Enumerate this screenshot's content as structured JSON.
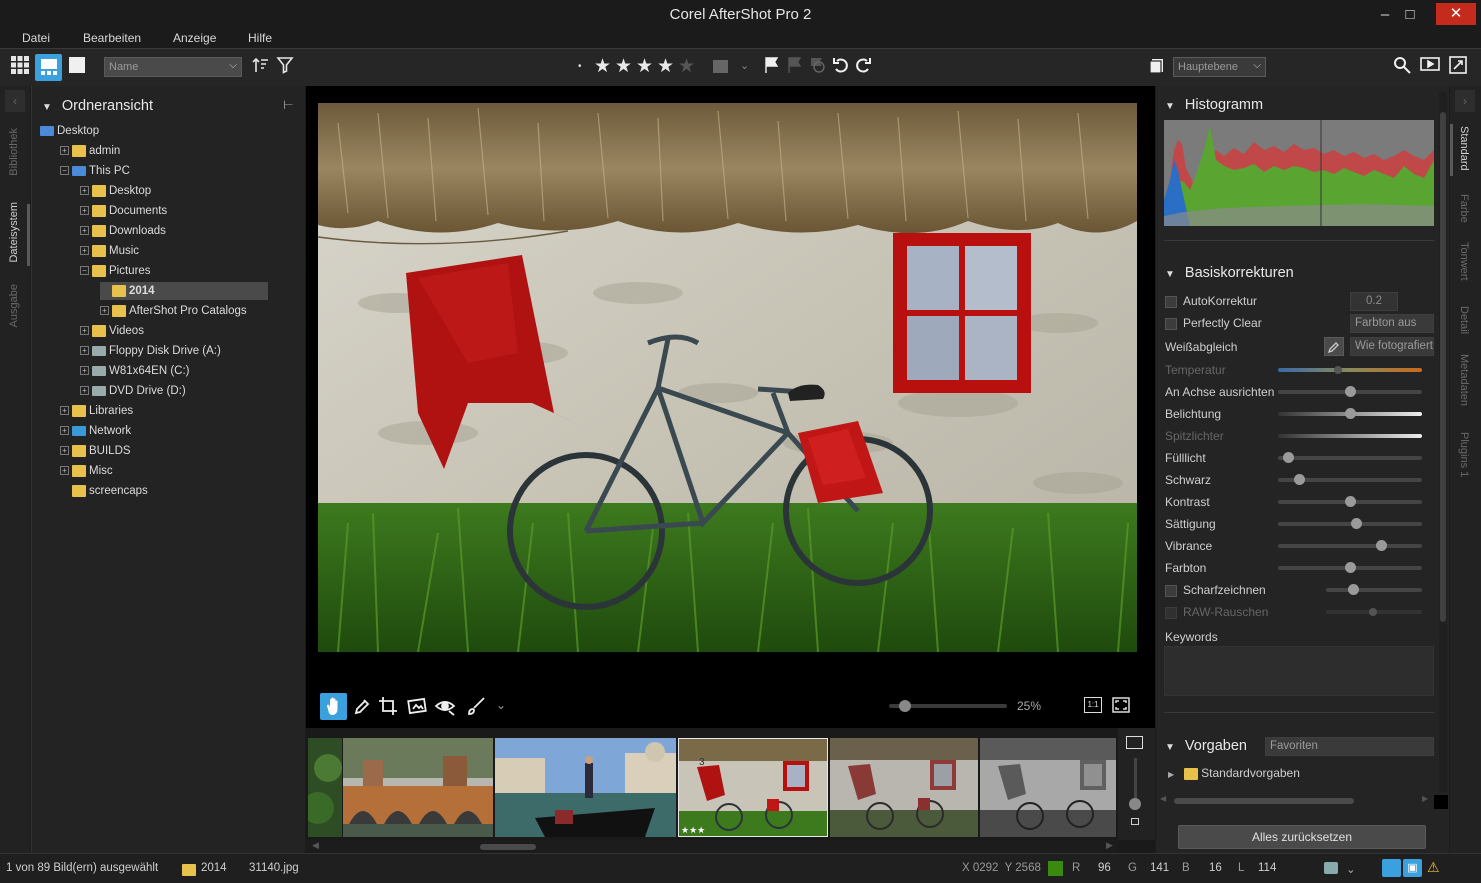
{
  "window": {
    "title": "Corel AfterShot Pro 2"
  },
  "menu": [
    "Datei",
    "Bearbeiten",
    "Anzeige",
    "Hilfe"
  ],
  "toolbar": {
    "sort_field": "Name",
    "layer_select": "Hauptebene",
    "rating_stars": 4,
    "rating_max": 5
  },
  "left_tabs": [
    "Bibliothek",
    "Dateisystem",
    "Ausgabe"
  ],
  "left_panel": {
    "title": "Ordneransicht",
    "tree": [
      {
        "label": "Desktop",
        "depth": 0,
        "expander": "",
        "kind": "desktop"
      },
      {
        "label": "admin",
        "depth": 1,
        "expander": "+",
        "kind": "user"
      },
      {
        "label": "This PC",
        "depth": 1,
        "expander": "−",
        "kind": "pc"
      },
      {
        "label": "Desktop",
        "depth": 2,
        "expander": "+",
        "kind": "folder"
      },
      {
        "label": "Documents",
        "depth": 2,
        "expander": "+",
        "kind": "folder"
      },
      {
        "label": "Downloads",
        "depth": 2,
        "expander": "+",
        "kind": "folder"
      },
      {
        "label": "Music",
        "depth": 2,
        "expander": "+",
        "kind": "folder"
      },
      {
        "label": "Pictures",
        "depth": 2,
        "expander": "−",
        "kind": "folder"
      },
      {
        "label": "2014",
        "depth": 3,
        "expander": "",
        "kind": "folder",
        "selected": true
      },
      {
        "label": "AfterShot Pro Catalogs",
        "depth": 3,
        "expander": "+",
        "kind": "folder"
      },
      {
        "label": "Videos",
        "depth": 2,
        "expander": "+",
        "kind": "folder"
      },
      {
        "label": "Floppy Disk Drive (A:)",
        "depth": 2,
        "expander": "+",
        "kind": "drive"
      },
      {
        "label": "W81x64EN (C:)",
        "depth": 2,
        "expander": "+",
        "kind": "drive"
      },
      {
        "label": "DVD Drive (D:)",
        "depth": 2,
        "expander": "+",
        "kind": "drive"
      },
      {
        "label": "Libraries",
        "depth": 1,
        "expander": "+",
        "kind": "folder"
      },
      {
        "label": "Network",
        "depth": 1,
        "expander": "+",
        "kind": "network"
      },
      {
        "label": "BUILDS",
        "depth": 1,
        "expander": "+",
        "kind": "folder"
      },
      {
        "label": "Misc",
        "depth": 1,
        "expander": "+",
        "kind": "folder"
      },
      {
        "label": "screencaps",
        "depth": 1,
        "expander": "",
        "kind": "folder"
      }
    ]
  },
  "viewer": {
    "zoom": "25%",
    "zoom_fit_label": "1:1"
  },
  "filmstrip": {
    "thumbs": [
      {
        "name": "partial",
        "selected": false
      },
      {
        "name": "bridge",
        "selected": false
      },
      {
        "name": "gondola",
        "selected": false
      },
      {
        "name": "cottage",
        "selected": true,
        "number": "3",
        "stars": "★★★"
      },
      {
        "name": "cottage-muted",
        "selected": false
      },
      {
        "name": "cottage-bw",
        "selected": false
      }
    ]
  },
  "right_panel": {
    "histogram_title": "Histogramm",
    "basic_title": "Basiskorrekturen",
    "autokorrektur": {
      "label": "AutoKorrektur",
      "value": "0.2"
    },
    "perfectly_clear": {
      "label": "Perfectly Clear",
      "value": "Farbton aus"
    },
    "white_balance": {
      "label": "Weißabgleich",
      "value": "Wie fotografiert"
    },
    "sliders": [
      {
        "label": "Temperatur",
        "pos": 0.42,
        "disabled": true,
        "temp": true
      },
      {
        "label": "An Achse ausrichten",
        "pos": 0.5,
        "disabled": false
      },
      {
        "label": "Belichtung",
        "pos": 0.5,
        "disabled": false,
        "fill": true
      },
      {
        "label": "Spitzlichter",
        "pos": 1.0,
        "disabled": true,
        "fill": true,
        "noknob": true
      },
      {
        "label": "Fülllicht",
        "pos": 0.04,
        "disabled": false
      },
      {
        "label": "Schwarz",
        "pos": 0.12,
        "disabled": false
      },
      {
        "label": "Kontrast",
        "pos": 0.5,
        "disabled": false
      },
      {
        "label": "Sättigung",
        "pos": 0.55,
        "disabled": false
      },
      {
        "label": "Vibrance",
        "pos": 0.74,
        "disabled": false
      },
      {
        "label": "Farbton",
        "pos": 0.5,
        "disabled": false
      }
    ],
    "sharpen": {
      "label": "Scharfzeichnen",
      "pos": 0.28
    },
    "raw_noise": {
      "label": "RAW-Rauschen",
      "pos": 0.5
    },
    "keywords_label": "Keywords",
    "presets_title": "Vorgaben",
    "presets_select": "Favoriten",
    "presets_item": "Standardvorgaben",
    "reset_button": "Alles zurücksetzen"
  },
  "right_tabs": [
    "Standard",
    "Farbe",
    "Tonwert",
    "Detail",
    "Metadaten",
    "Plugins 1"
  ],
  "status": {
    "selection": "1 von 89 Bild(ern) ausgewählt",
    "folder": "2014",
    "file": "31140.jpg",
    "coords": "X 0292  Y 2568",
    "r_label": "R",
    "r": "96",
    "g_label": "G",
    "g": "141",
    "b_label": "B",
    "b": "16",
    "l_label": "L",
    "l": "114",
    "pixel_color": "#3a8a10"
  }
}
